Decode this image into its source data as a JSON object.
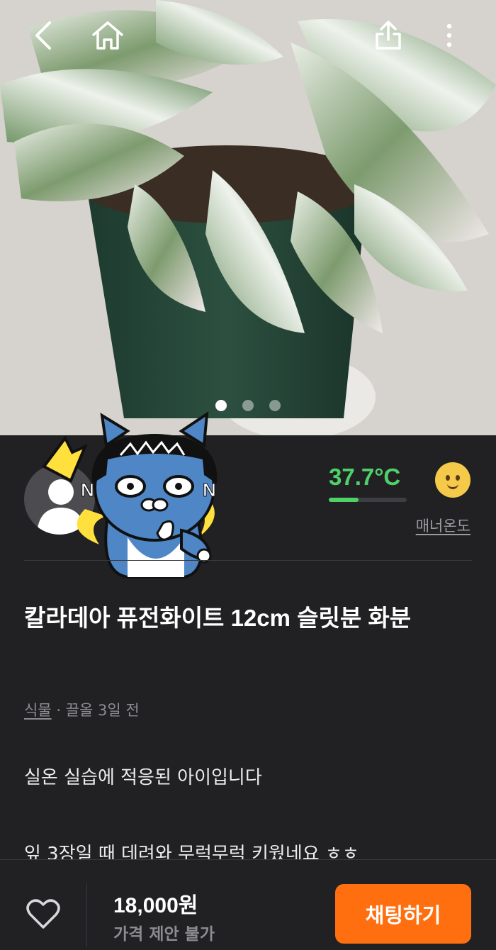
{
  "photo": {
    "page_count": 3,
    "active_page": 1,
    "icons": [
      "back-icon",
      "home-icon",
      "share-icon",
      "more-icon"
    ]
  },
  "seller": {
    "manner_temp": "37.7°C",
    "manner_temp_level": 0.38,
    "manner_label": "매너온도",
    "temp_color": "#4fd16a"
  },
  "product": {
    "title": "칼라데아 퓨전화이트 12cm 슬릿분 화분",
    "category": "식물",
    "meta_sep": " · ",
    "bump_time": "끌올 3일 전",
    "desc_lines": [
      "실온 실습에 적응된 아이입니다",
      "",
      "잎 3장일 때 데려와 무럭무럭 키웠네요 ㅎㅎ"
    ]
  },
  "bottom": {
    "price": "18,000원",
    "price_note": "가격 제안 불가",
    "chat_label": "채팅하기",
    "accent": "#ff6f0f"
  }
}
